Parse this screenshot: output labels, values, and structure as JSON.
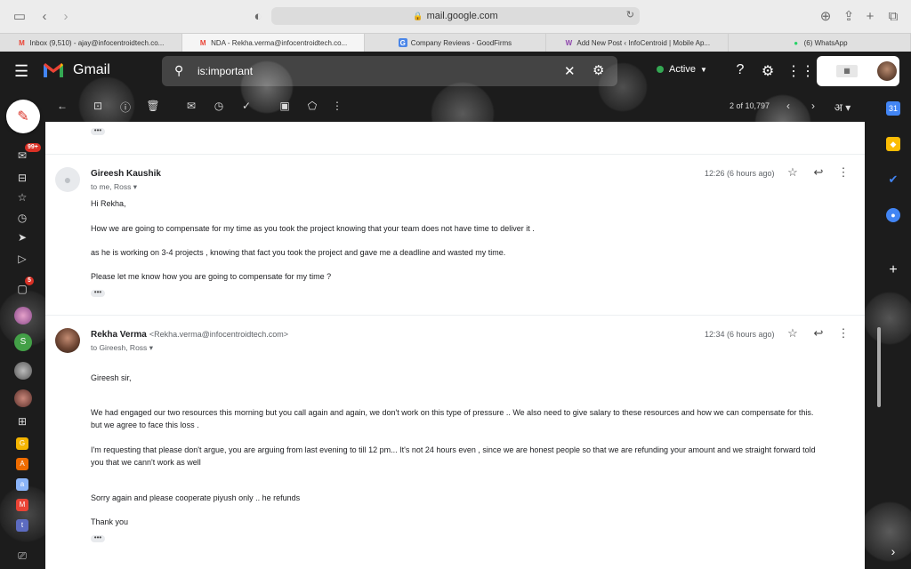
{
  "browser": {
    "url": "mail.google.com",
    "tabs": [
      {
        "favicon": "M",
        "favicon_color": "#ea4335",
        "label": "Inbox (9,510) - ajay@infocentroidtech.co...",
        "active": false
      },
      {
        "favicon": "M",
        "favicon_color": "#ea4335",
        "label": "NDA - Rekha.verma@infocentroidtech.co...",
        "active": true
      },
      {
        "favicon": "G",
        "favicon_color": "#4a86e8",
        "label": "Company Reviews - GoodFirms",
        "active": false
      },
      {
        "favicon": "W",
        "favicon_color": "#8e44ad",
        "label": "Add New Post ‹ InfoCentroid | Mobile Ap...",
        "active": false
      },
      {
        "favicon": "●",
        "favicon_color": "#25d366",
        "label": "(6) WhatsApp",
        "active": false
      }
    ]
  },
  "gmail": {
    "logo_text": "Gmail",
    "search_query": "is:important",
    "status": "Active",
    "page_count": "2 of 10,797",
    "lang_label": "अ",
    "rail_badges": {
      "mail": "99+",
      "chat": "5"
    },
    "rail_avatar_letter": "S",
    "rail_apps": [
      {
        "letter": "G",
        "color": "#f4b400"
      },
      {
        "letter": "A",
        "color": "#ef6c00"
      },
      {
        "letter": "a",
        "color": "#8ab4f8"
      },
      {
        "letter": "M",
        "color": "#ea4335"
      },
      {
        "letter": "t",
        "color": "#5c6bc0"
      }
    ]
  },
  "messages": [
    {
      "sender": "Gireesh Kaushik",
      "email": "",
      "recipients": "to me, Ross",
      "time": "12:26 (6 hours ago)",
      "body": [
        "Hi Rekha,",
        "How we are going to compensate for my time as you took the project knowing that your team does not have time to deliver it .",
        "as he is working on 3-4 projects , knowing that fact you took the project and gave me a deadline and wasted my time.",
        "Please let me know how you are going to compensate for my time ?"
      ]
    },
    {
      "sender": "Rekha Verma",
      "email": "<Rekha.verma@infocentroidtech.com>",
      "recipients": "to Gireesh, Ross",
      "time": "12:34 (6 hours ago)",
      "body": [
        "Gireesh sir,",
        "We had engaged our two resources this morning but you call again and again, we don't work  on this type of pressure .. We also need to give salary to these resources and how we can compensate for this.",
        " but we agree to face this loss .",
        "I'm requesting that please don't argue, you are arguing from last evening to till 12 pm...  It's not 24 hours even , since we are honest people so that we are refunding your amount  and we straight forward told",
        "you that we cann't work as well",
        "Sorry again and please cooperate piyush only .. he refunds",
        "Thank you"
      ]
    }
  ]
}
